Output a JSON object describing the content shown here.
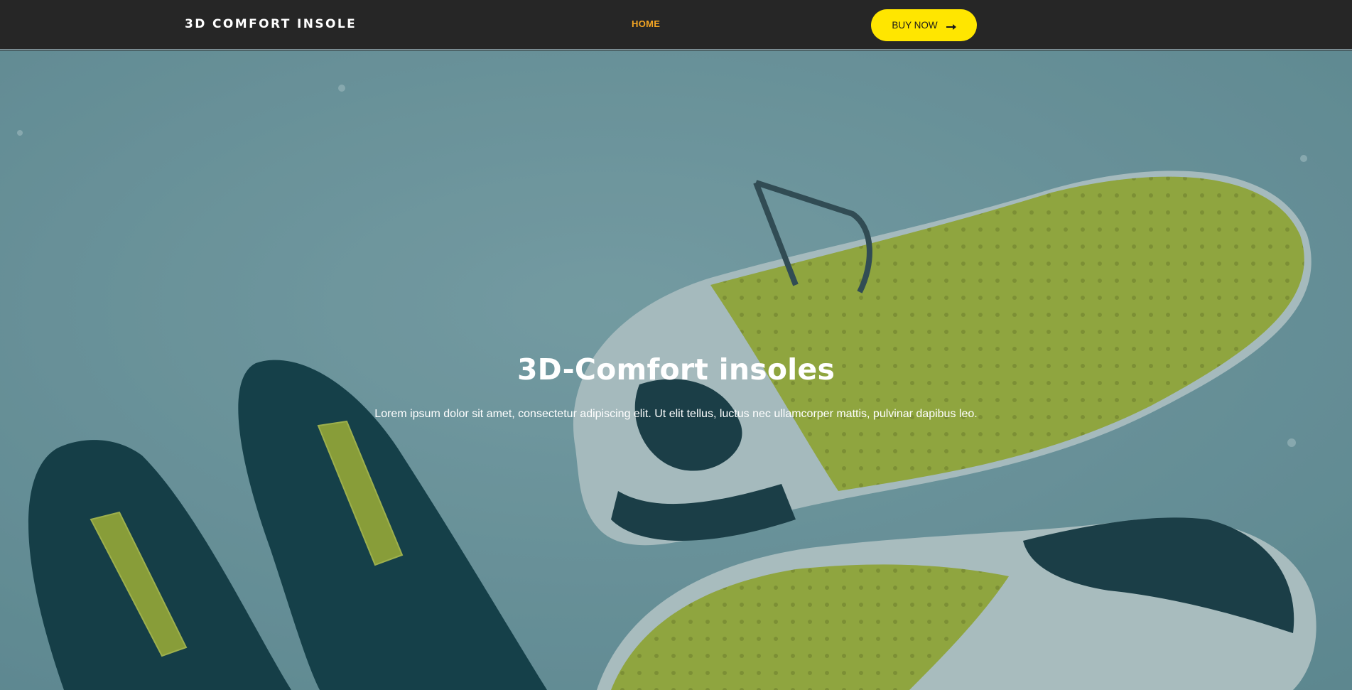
{
  "header": {
    "brand": "3D COMFORT INSOLE",
    "nav": [
      {
        "label": "HOME",
        "active": true
      }
    ],
    "cta": {
      "label": "BUY NOW",
      "icon": "arrow-right-icon"
    }
  },
  "hero": {
    "title": "3D-Comfort insoles",
    "text": "Lorem ipsum dolor sit amet, consectetur adipiscing elit. Ut elit tellus, luctus nec ullamcorper mattis, pulvinar dapibus leo."
  },
  "colors": {
    "nav_bg": "#262626",
    "accent_orange": "#f5a623",
    "button_yellow": "#ffe600",
    "hero_tint": "#7fa5ab",
    "sole_green": "#b7c43a"
  }
}
